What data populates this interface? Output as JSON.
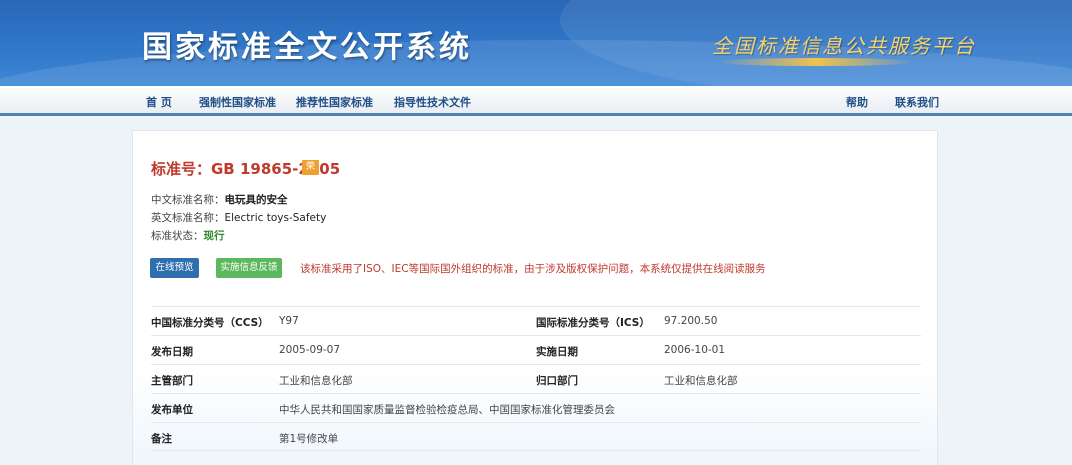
{
  "header": {
    "site_title": "国家标准全文公开系统",
    "slogan": "全国标准信息公共服务平台"
  },
  "nav": {
    "items": [
      "首 页",
      "强制性国家标准",
      "推荐性国家标准",
      "指导性技术文件"
    ],
    "help": "帮助",
    "contact": "联系我们"
  },
  "standard": {
    "title": "标准号：GB 19865-2005",
    "badge": "荣",
    "cn_name_label": "中文标准名称：",
    "cn_name": "电玩具的安全",
    "en_name_label": "英文标准名称：",
    "en_name": "Electric toys-Safety",
    "status_label": "标准状态：",
    "status": "现行"
  },
  "actions": {
    "preview": "在线预览",
    "feedback": "实施信息反馈",
    "notice": "该标准采用了ISO、IEC等国际国外组织的标准，由于涉及版权保护问题，本系统仅提供在线阅读服务"
  },
  "details": {
    "ccs_label": "中国标准分类号（CCS）",
    "ccs": "Y97",
    "ics_label": "国际标准分类号（ICS）",
    "ics": "97.200.50",
    "pub_date_label": "发布日期",
    "pub_date": "2005-09-07",
    "impl_date_label": "实施日期",
    "impl_date": "2006-10-01",
    "dept_label": "主管部门",
    "dept": "工业和信息化部",
    "owner_label": "归口部门",
    "owner": "工业和信息化部",
    "issuer_label": "发布单位",
    "issuer": "中华人民共和国国家质量监督检验检疫总局、中国国家标准化管理委员会",
    "remark_label": "备注",
    "remark": "第1号修改单"
  }
}
